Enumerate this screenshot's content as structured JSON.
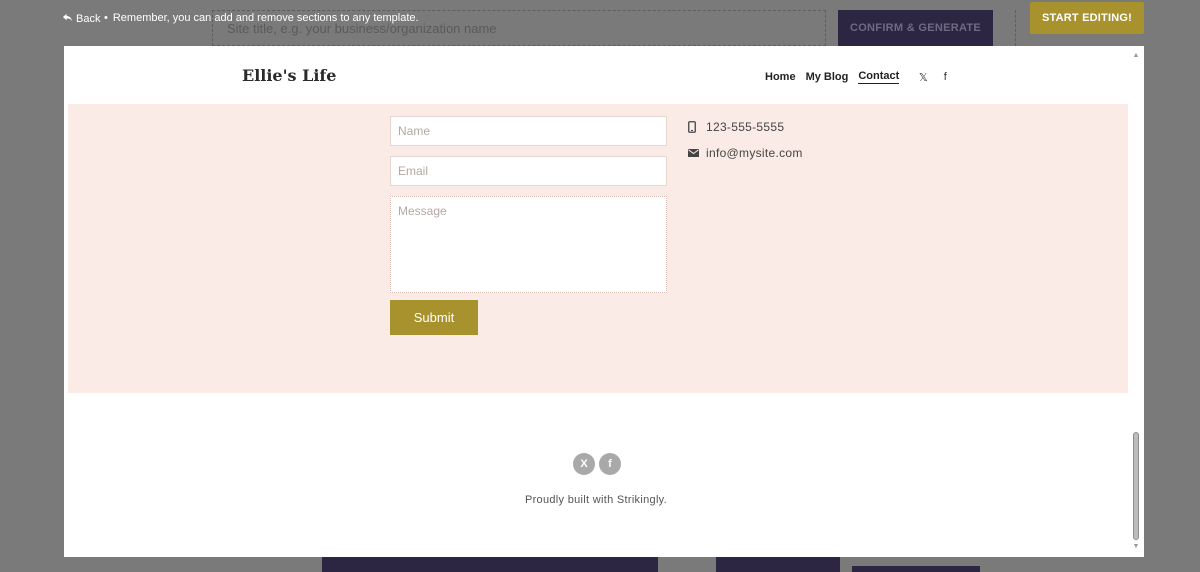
{
  "editor": {
    "back_label": "Back",
    "notice": "Remember, you can add and remove sections to any template.",
    "site_title_placeholder": "Site title, e.g. your business/organization name",
    "confirm_label": "CONFIRM & GENERATE",
    "start_editing_label": "START EDITING!",
    "accent_color": "#a7922e"
  },
  "site": {
    "brand": "Ellie's Life",
    "nav": {
      "items": [
        "Home",
        "My Blog",
        "Contact"
      ],
      "active": "Contact",
      "social_x": "𝕏",
      "social_facebook": "f"
    },
    "contact_form": {
      "name_placeholder": "Name",
      "email_placeholder": "Email",
      "message_placeholder": "Message",
      "submit_label": "Submit"
    },
    "contact_info": {
      "phone": "123-555-5555",
      "email": "info@mysite.com"
    },
    "footer": {
      "text": "Proudly built with Strikingly.",
      "social_x": "X",
      "social_facebook": "f"
    },
    "section_bg": "#fbebe7"
  },
  "icons": [
    "back-arrow-icon",
    "mobile-phone-icon",
    "envelope-icon",
    "x-icon",
    "facebook-icon",
    "scroll-up-icon",
    "scroll-down-icon"
  ]
}
